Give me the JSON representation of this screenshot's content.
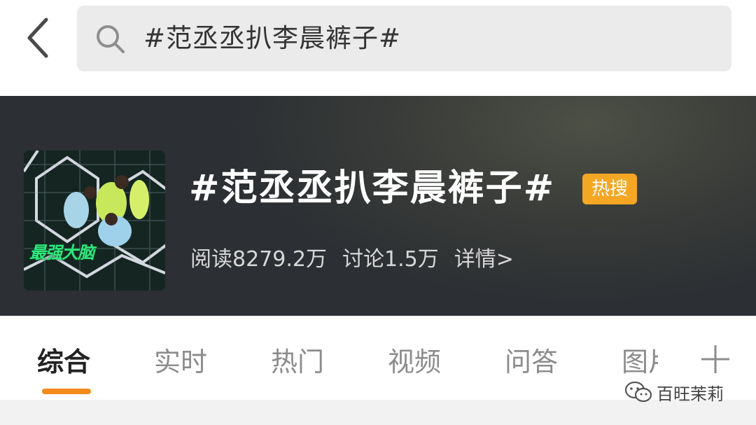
{
  "search": {
    "query": "#范丞丞扒李晨裤子#"
  },
  "banner": {
    "thumbnail_caption": "最强大脑",
    "topic_title": "#范丞丞扒李晨裤子#",
    "hot_badge": "热搜",
    "reads": "阅读8279.2万",
    "discussions": "讨论1.5万",
    "details_link": "详情>"
  },
  "tabs": [
    {
      "label": "综合",
      "active": true
    },
    {
      "label": "实时",
      "active": false
    },
    {
      "label": "热门",
      "active": false
    },
    {
      "label": "视频",
      "active": false
    },
    {
      "label": "问答",
      "active": false
    },
    {
      "label": "图片",
      "active": false
    }
  ],
  "icons": {
    "back": "chevron-left-icon",
    "search": "search-icon",
    "add": "plus-icon",
    "watermark": "wechat-icon"
  },
  "watermark": {
    "text": "百旺茉莉"
  },
  "colors": {
    "accent": "#f28a1d",
    "hot_badge": "#f5a623",
    "search_bg": "#ebebeb",
    "banner_bg": "#303338"
  }
}
